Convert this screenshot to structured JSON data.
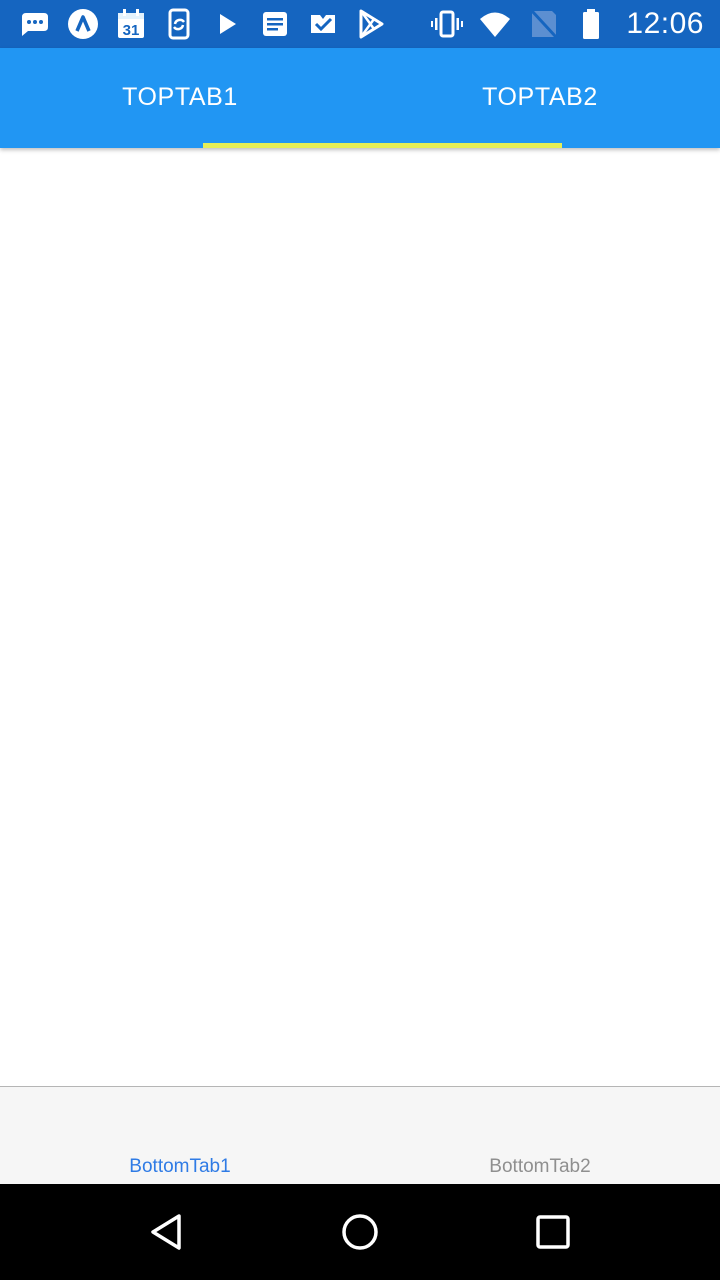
{
  "status_bar": {
    "time": "12:06",
    "left_icons": [
      "messages-icon",
      "app-a-icon",
      "calendar-icon",
      "sync-phone-icon",
      "play-icon",
      "notes-icon",
      "check-badge-icon",
      "play-store-icon"
    ],
    "right_icons": [
      "vibrate-icon",
      "wifi-icon",
      "no-signal-icon",
      "battery-icon"
    ],
    "calendar_day": "31"
  },
  "top_tabs": {
    "items": [
      {
        "label": "TOPTAB1"
      },
      {
        "label": "TOPTAB2"
      }
    ],
    "background": "#2196f3",
    "indicator_color": "#e6ee56"
  },
  "bottom_tabs": {
    "items": [
      {
        "label": "BottomTab1",
        "active": true
      },
      {
        "label": "BottomTab2",
        "active": false
      }
    ],
    "active_color": "#2f7be5",
    "inactive_color": "#8f8f8f"
  },
  "nav_bar": {
    "icons": [
      "back-icon",
      "home-icon",
      "recents-icon"
    ]
  }
}
